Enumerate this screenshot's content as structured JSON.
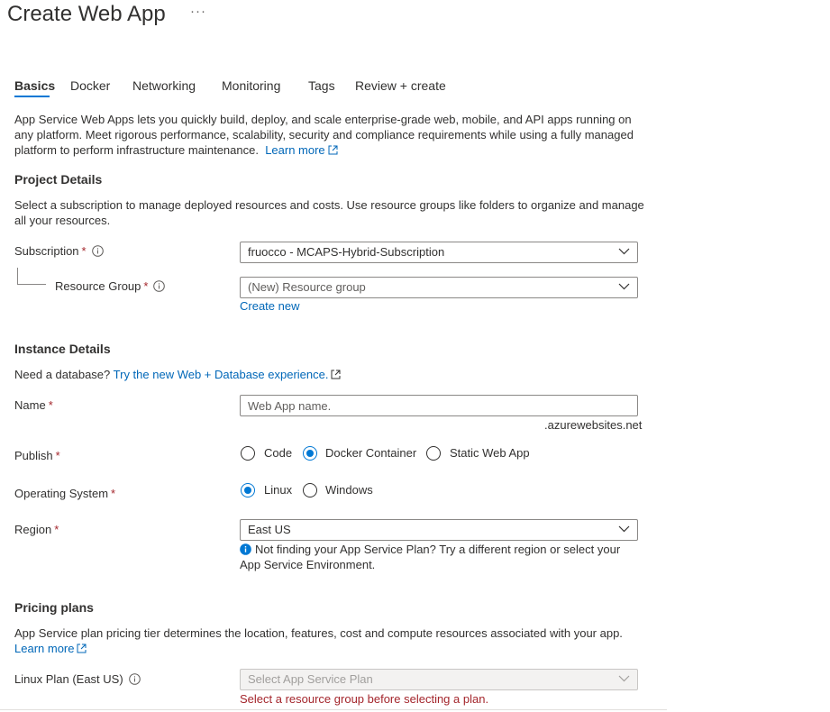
{
  "page": {
    "title": "Create Web App",
    "more": "···"
  },
  "tabs": [
    {
      "label": "Basics",
      "active": true
    },
    {
      "label": "Docker"
    },
    {
      "label": "Networking"
    },
    {
      "label": "Monitoring"
    },
    {
      "label": "Tags"
    },
    {
      "label": "Review + create"
    }
  ],
  "intro": {
    "text": "App Service Web Apps lets you quickly build, deploy, and scale enterprise-grade web, mobile, and API apps running on any platform. Meet rigorous performance, scalability, security and compliance requirements while using a fully managed platform to perform infrastructure maintenance.",
    "link": "Learn more"
  },
  "project": {
    "heading": "Project Details",
    "description": "Select a subscription to manage deployed resources and costs. Use resource groups like folders to organize and manage all your resources.",
    "subscription_label": "Subscription",
    "subscription_value": "fruocco - MCAPS-Hybrid-Subscription",
    "rg_label": "Resource Group",
    "rg_placeholder": "(New) Resource group",
    "create_new": "Create new",
    "required_mark": "*"
  },
  "instance": {
    "heading": "Instance Details",
    "db_prompt": "Need a database?",
    "db_link": "Try the new Web + Database experience.",
    "name_label": "Name",
    "name_placeholder": "Web App name.",
    "name_suffix": ".azurewebsites.net",
    "publish_label": "Publish",
    "publish_options": [
      "Code",
      "Docker Container",
      "Static Web App"
    ],
    "publish_selected": "Docker Container",
    "os_label": "Operating System",
    "os_options": [
      "Linux",
      "Windows"
    ],
    "os_selected": "Linux",
    "region_label": "Region",
    "region_value": "East US",
    "region_note": "Not finding your App Service Plan? Try a different region or select your App Service Environment."
  },
  "pricing": {
    "heading": "Pricing plans",
    "description": "App Service plan pricing tier determines the location, features, cost and compute resources associated with your app.",
    "link": "Learn more",
    "plan_label": "Linux Plan (East US)",
    "plan_placeholder": "Select App Service Plan",
    "plan_error": "Select a resource group before selecting a plan."
  },
  "colors": {
    "accent": "#0078d4",
    "link": "#0067b8",
    "error": "#a4262c",
    "text": "#323130"
  }
}
